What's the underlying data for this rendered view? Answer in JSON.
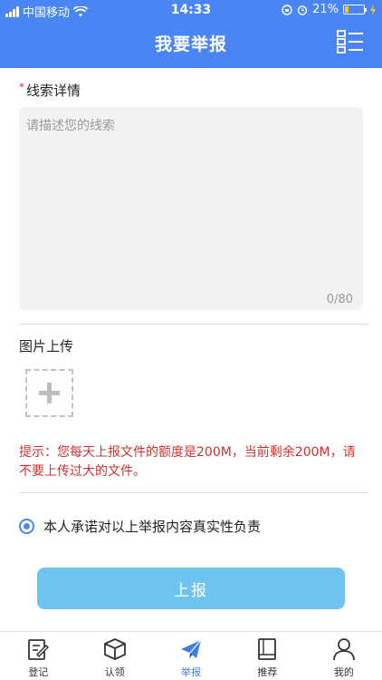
{
  "status_bar": {
    "carrier": "中国移动",
    "time": "14:33",
    "battery": "21%",
    "battery_level": 0.21
  },
  "header": {
    "title": "我要举报"
  },
  "form": {
    "detail_label": "线索详情",
    "required_mark": "*",
    "detail_placeholder": "请描述您的线索",
    "detail_value": "",
    "char_count": "0/80",
    "image_label": "图片上传",
    "notice": "提示：您每天上报文件的额度是200M，当前剩余200M，请不要上传过大的文件。",
    "agreement": "本人承诺对以上举报内容真实性负责",
    "agreement_checked": true,
    "submit_label": "上报"
  },
  "tabs": [
    {
      "label": "登记",
      "icon": "edit-icon",
      "active": false
    },
    {
      "label": "认领",
      "icon": "box-icon",
      "active": false
    },
    {
      "label": "举报",
      "icon": "paper-plane-icon",
      "active": true
    },
    {
      "label": "推荐",
      "icon": "book-icon",
      "active": false
    },
    {
      "label": "我的",
      "icon": "user-icon",
      "active": false
    }
  ],
  "colors": {
    "primary": "#4a86f3",
    "submit": "#6fc3ef",
    "notice": "#d32f2f",
    "active_tab": "#3d7de8"
  }
}
